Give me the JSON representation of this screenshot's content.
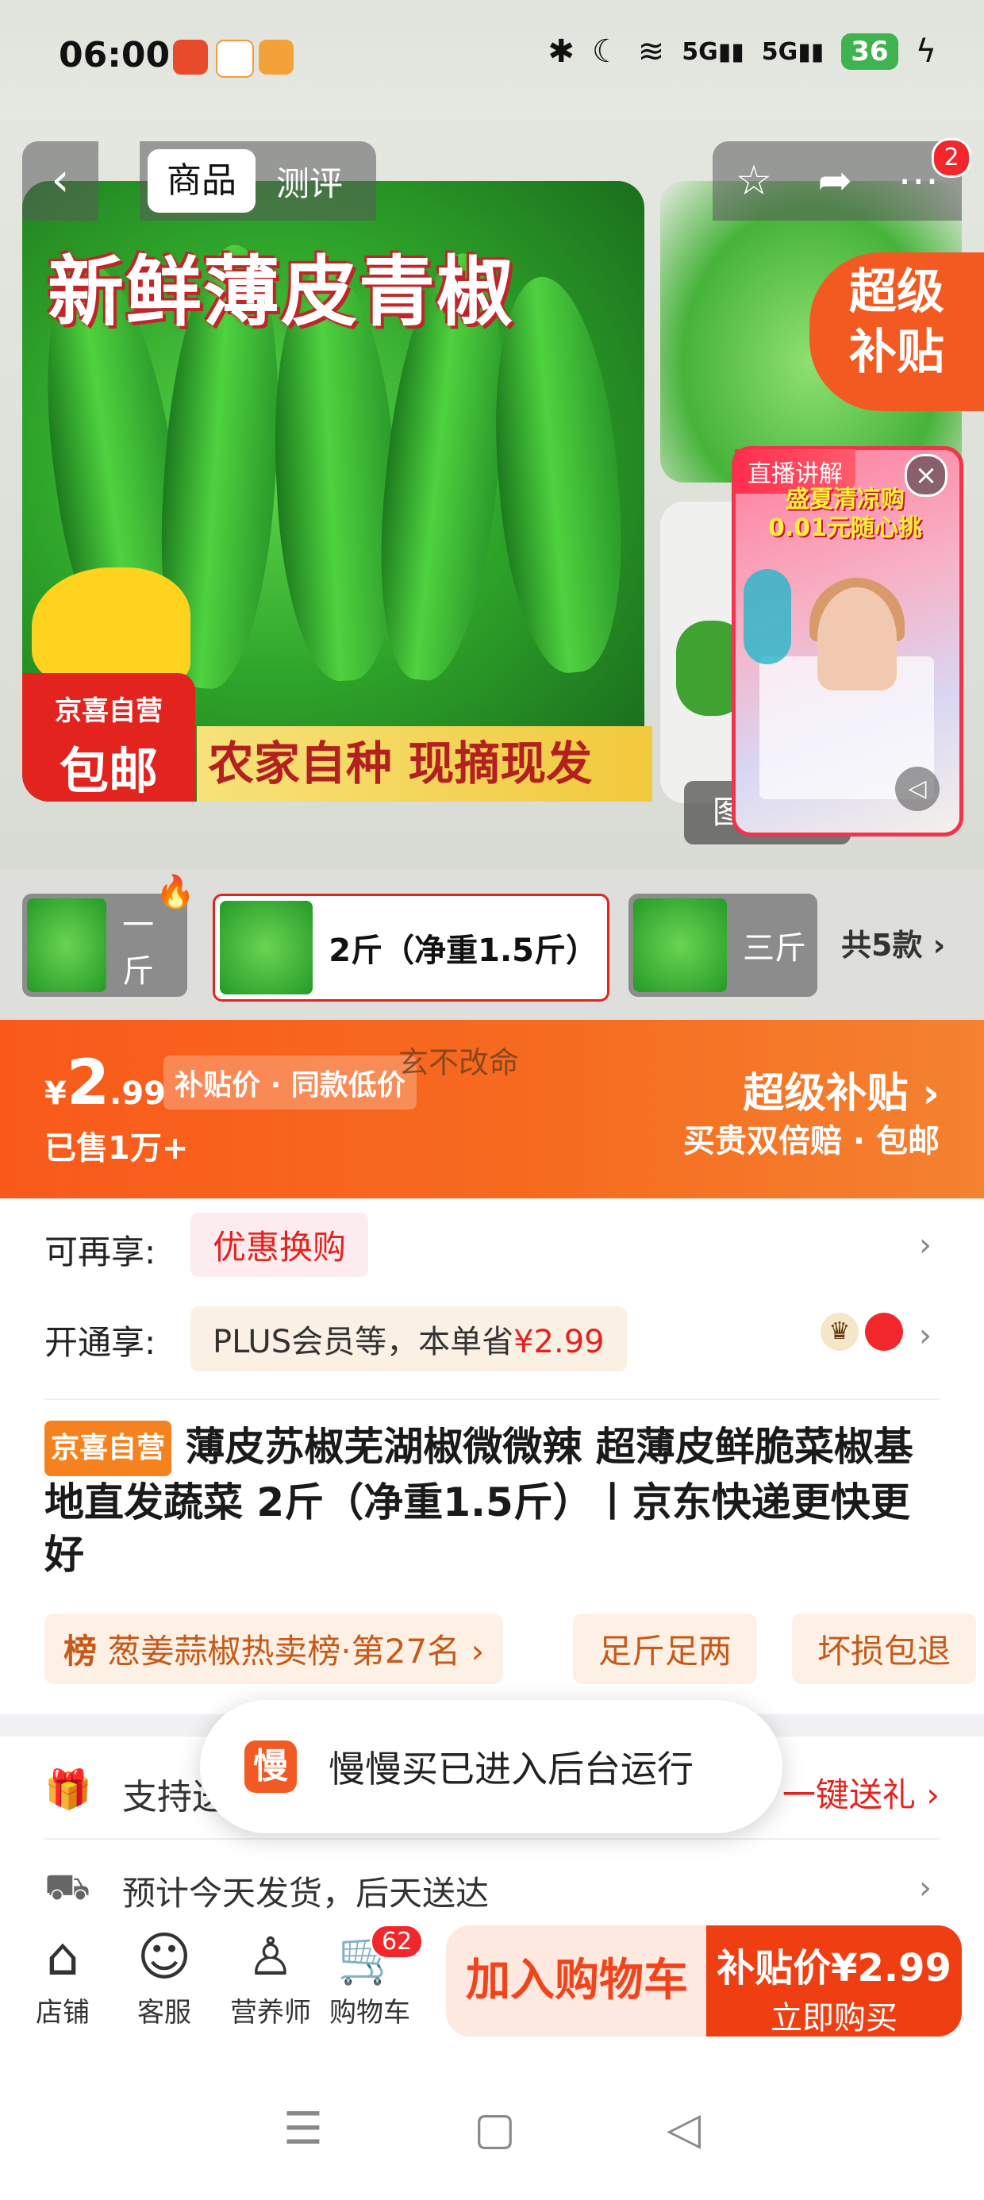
{
  "status_bar": {
    "time": "06:00",
    "network": "5G",
    "battery": "36"
  },
  "gallery": {
    "back_glyph": "‹",
    "tabs": [
      "商品",
      "测评"
    ],
    "image_title": "新鲜薄皮青椒",
    "image_slogan": "农家自种 现摘现发",
    "badge_line1": "京喜自营",
    "badge_line2": "包邮",
    "super_subsidy_line1": "超级",
    "super_subsidy_line2": "补贴",
    "notification_count": "2",
    "live_tag": "直播讲解",
    "live_promo_line1": "盛夏清凉购",
    "live_promo_line2": "0.01元随心挑",
    "image_tab_label": "图"
  },
  "variants": [
    {
      "label": "一斤"
    },
    {
      "label": "2斤（净重1.5斤）"
    },
    {
      "label": "三斤"
    }
  ],
  "variant_count": "共5款 ›",
  "price_bar": {
    "currency": "¥",
    "price_big": "2",
    "price_small": ".99",
    "price_tag": "补贴价 · 同款低价",
    "sold": "已售1万+",
    "watermark": "玄不改命",
    "super_subsidy": "超级补贴 ›",
    "guarantee": "买贵双倍赔 · 包邮"
  },
  "benefits": {
    "row1_label": "可再享:",
    "row1_chip": "优惠换购",
    "row2_label": "开通享:",
    "row2_chip_text": "PLUS会员等，本单省",
    "row2_chip_amount": "¥2.99"
  },
  "product": {
    "tag": "京喜自营",
    "title": "薄皮苏椒芜湖椒微微辣 超薄皮鲜脆菜椒基地直发蔬菜 2斤（净重1.5斤）丨京东快递更快更好",
    "rank_icon": "榜",
    "rank": "葱姜蒜椒热卖榜·第27名 ›",
    "features": [
      "足斤足两",
      "坏损包退"
    ]
  },
  "services": {
    "gift_text": "支持送",
    "gift_action": "一键送礼 ›",
    "delivery": "预计今天发货，后天送达"
  },
  "toast": {
    "icon_char": "慢",
    "text": "慢慢买已进入后台运行"
  },
  "bottom_bar": {
    "shop": "店铺",
    "service": "客服",
    "nutritionist": "营养师",
    "cart": "购物车",
    "cart_count": "62",
    "add_to_cart": "加入购物车",
    "buy_price": "补贴价¥2.99",
    "buy_now": "立即购买"
  },
  "colors": {
    "accent": "#f95a1a",
    "red": "#e3231e",
    "buy": "#ef3f12"
  }
}
